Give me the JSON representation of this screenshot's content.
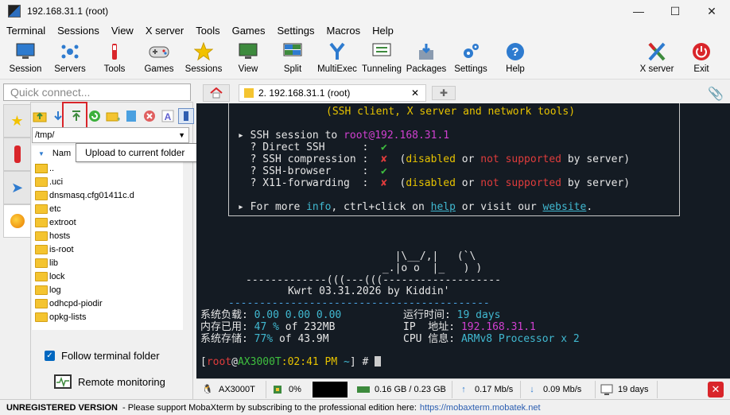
{
  "window": {
    "title": "192.168.31.1 (root)",
    "min": "—",
    "max": "☐",
    "close": "✕"
  },
  "menu": [
    "Terminal",
    "Sessions",
    "View",
    "X server",
    "Tools",
    "Games",
    "Settings",
    "Macros",
    "Help"
  ],
  "toolbar": {
    "session": "Session",
    "servers": "Servers",
    "tools": "Tools",
    "games": "Games",
    "sessions": "Sessions",
    "view": "View",
    "split": "Split",
    "multiexec": "MultiExec",
    "tunneling": "Tunneling",
    "packages": "Packages",
    "settings": "Settings",
    "help": "Help",
    "xserver": "X server",
    "exit": "Exit"
  },
  "quick_connect": {
    "placeholder": "Quick connect..."
  },
  "sftp": {
    "path": "/tmp/",
    "column_name": "Nam",
    "files": [
      "..",
      ".uci",
      "dnsmasq.cfg01411c.d",
      "etc",
      "extroot",
      "hosts",
      "is-root",
      "lib",
      "lock",
      "log",
      "odhcpd-piodir",
      "opkg-lists"
    ],
    "follow_label": "Follow terminal folder",
    "remote_label": "Remote monitoring",
    "tooltip": "Upload to current folder"
  },
  "tabs": {
    "session_tab": "2. 192.168.31.1 (root)"
  },
  "terminal": {
    "line_tools": "(SSH client, X server and network tools)",
    "ssh_session_pre": "▸ SSH session to ",
    "ssh_session_host": "root@192.168.31.1",
    "direct_ssh": "  ? Direct SSH      :  ",
    "ssh_compression": "  ? SSH compression :  ",
    "ssh_browser": "  ? SSH-browser     :  ",
    "x11": "  ? X11-forwarding  :  ",
    "check": "✔",
    "cross": "✘",
    "disabled": "disabled",
    "or": " or ",
    "not_supported": "not supported",
    "by_server": " by server)",
    "open_paren": "  (",
    "more_pre": "▸ For more ",
    "info": "info",
    "more_mid": ", ctrl+click on ",
    "help": "help",
    "more_mid2": " or visit our ",
    "website": "website",
    "more_end": ".",
    "art1": "              |\\__/,|   (`\\",
    "art2": "            _.|o o  |_   ) )",
    "art3": "-------------(((---(((-------------------",
    "banner": "Kwrt 03.31.2026 by Kiddin'",
    "dash": "------------------------------------------",
    "load_label": "系统负载: ",
    "load_val": "0.00 0.00 0.00",
    "uptime_label": "运行时间: ",
    "uptime_val": "19 days",
    "mem_label": "内存已用: ",
    "mem_pct": "47 %",
    "mem_of": " of 232MB",
    "ip_label": "IP  地址: ",
    "ip_val": "192.168.31.1",
    "disk_label": "系统存储: ",
    "disk_pct": "77%",
    "disk_of": " of 43.9M",
    "cpu_label": "CPU 信息: ",
    "cpu_val": "ARMv8 Processor x 2",
    "prompt_open": "[",
    "prompt_user": "root",
    "prompt_at": "@",
    "prompt_host": "AX3000T",
    "prompt_time": ":02:41 PM",
    "prompt_path": " ~",
    "prompt_close": "] # "
  },
  "status": {
    "host": "AX3000T",
    "cpu": "0%",
    "mem": "0.16 GB / 0.23 GB",
    "up": "0.17 Mb/s",
    "down": "0.09 Mb/s",
    "uptime": "19 days"
  },
  "bottom": {
    "unreg": "UNREGISTERED VERSION",
    "msg": " -  Please support MobaXterm by subscribing to the professional edition here:",
    "link": "https://mobaxterm.mobatek.net"
  }
}
